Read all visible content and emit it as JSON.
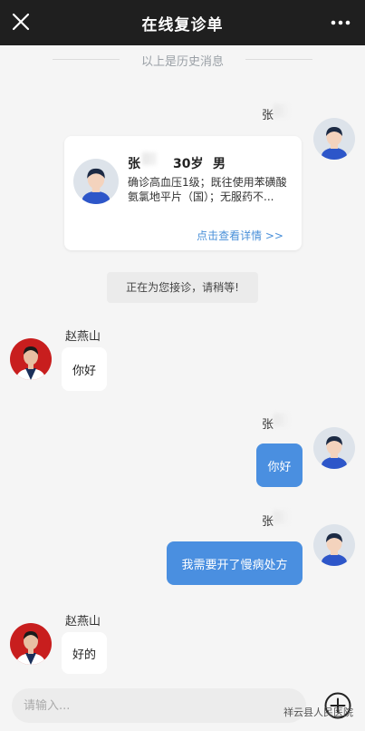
{
  "header": {
    "title": "在线复诊单"
  },
  "history_divider": "以上是历史消息",
  "patient": {
    "sender_name": "张",
    "card": {
      "name": "张",
      "age": "30岁",
      "sex": "男",
      "diagnosis": "确诊高血压1级；既往使用苯磺酸氨氯地平片（国）；无服药不...",
      "detail_link": "点击查看详情 >>"
    }
  },
  "system_notice": "正在为您接诊，请稍等!",
  "messages": [
    {
      "sender": "赵燕山",
      "text": "你好"
    },
    {
      "sender": "张",
      "text": "你好"
    },
    {
      "sender": "张",
      "text": "我需要开了慢病处方"
    },
    {
      "sender": "赵燕山",
      "text": "好的"
    }
  ],
  "input": {
    "placeholder": "请输入..."
  },
  "watermark": "祥云县人民医院",
  "colors": {
    "header_bg": "#1f1f1f",
    "outgoing_bubble": "#4a8fe0",
    "link": "#4a90d9",
    "doctor_avatar_bg": "#c81e1e"
  }
}
